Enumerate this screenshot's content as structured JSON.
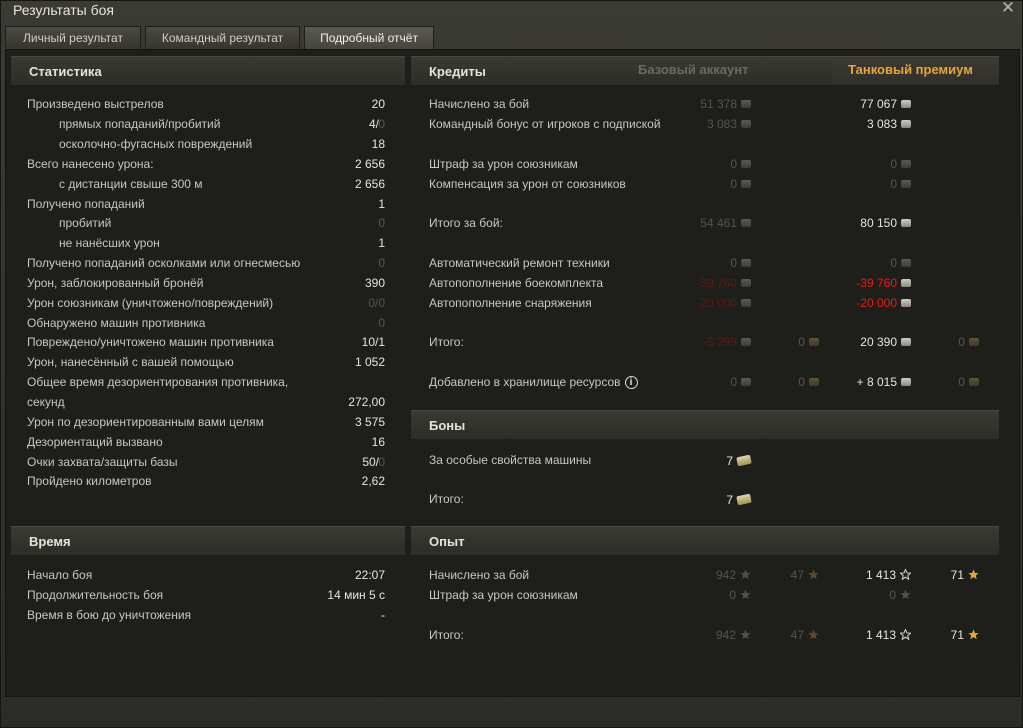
{
  "window": {
    "title": "Результаты боя",
    "close": "✕"
  },
  "tabs": [
    "Личный результат",
    "Командный результат",
    "Подробный отчёт"
  ],
  "stats": {
    "title": "Статистика",
    "rows": [
      {
        "label": "Произведено выстрелов",
        "value": "20"
      },
      {
        "label": "прямых попаданий/пробитий",
        "value": "4/",
        "value2": "0"
      },
      {
        "label": "осколочно-фугасных повреждений",
        "value": "18"
      },
      {
        "label": "Всего нанесено урона:",
        "value": "2 656"
      },
      {
        "label": "с дистанции свыше 300 м",
        "value": "2 656"
      },
      {
        "label": "Получено попаданий",
        "value": "1"
      },
      {
        "label": "пробитий",
        "value": "0"
      },
      {
        "label": "не нанёсших урон",
        "value": "1"
      },
      {
        "label": "Получено попаданий осколками или огнесмесью",
        "value": "0"
      },
      {
        "label": "Урон, заблокированный бронёй",
        "value": "390"
      },
      {
        "label": "Урон союзникам (уничтожено/повреждений)",
        "value": "0/0"
      },
      {
        "label": "Обнаружено машин противника",
        "value": "0"
      },
      {
        "label": "Повреждено/уничтожено машин противника",
        "value": "10/1"
      },
      {
        "label": "Урон, нанесённый с вашей помощью",
        "value": "1 052"
      },
      {
        "label": "Общее время дезориентирования противника,",
        "value": ""
      },
      {
        "label": "секунд",
        "value": "272,00"
      },
      {
        "label": "Урон по дезориентированным вами целям",
        "value": "3 575"
      },
      {
        "label": "Дезориентаций вызвано",
        "value": "16"
      },
      {
        "label": "Очки захвата/защиты базы",
        "value": "50/",
        "value2": "0"
      },
      {
        "label": "Пройдено километров",
        "value": "2,62"
      }
    ]
  },
  "time": {
    "title": "Время",
    "rows": [
      {
        "label": "Начало боя",
        "value": "22:07"
      },
      {
        "label": "Продолжительность боя",
        "value": "14 мин 5 с"
      },
      {
        "label": "Время в бою до уничтожения",
        "value": "-"
      }
    ]
  },
  "credits": {
    "title": "Кредиты",
    "col_base": "Базовый аккаунт",
    "col_prem": "Танковый премиум",
    "rows": [
      {
        "label": "Начислено за бой",
        "base": "51 378",
        "prem": "77 067"
      },
      {
        "label": "Командный бонус от игроков с подпиской",
        "base": "3 083",
        "prem": "3 083"
      },
      {
        "label": "Штраф за урон союзникам",
        "base": "0",
        "prem": "0"
      },
      {
        "label": "Компенсация за урон от союзников",
        "base": "0",
        "prem": "0"
      },
      {
        "label": "Итого за бой:",
        "base": "54 461",
        "prem": "80 150"
      },
      {
        "label": "Автоматический ремонт техники",
        "base": "0",
        "prem": "0"
      },
      {
        "label": "Автопополнение боекомплекта",
        "base": "-39 760",
        "prem": "-39 760"
      },
      {
        "label": "Автопополнение снаряжения",
        "base": "-20 000",
        "prem": "-20 000"
      },
      {
        "label": "Итого:",
        "base": "-5 299",
        "base_gold": "0",
        "prem": "20 390",
        "prem_gold": "0"
      },
      {
        "label": "Добавлено в хранилище ресурсов",
        "base": "0",
        "base_gold": "0",
        "prem": "+ 8 015",
        "prem_gold": "0"
      }
    ]
  },
  "bonds": {
    "title": "Боны",
    "rows": [
      {
        "label": "За особые свойства машины",
        "value": "7"
      },
      {
        "label": "Итого:",
        "value": "7"
      }
    ]
  },
  "xp": {
    "title": "Опыт",
    "rows": [
      {
        "label": "Начислено за бой",
        "base": "942",
        "base_free": "47",
        "prem": "1 413",
        "prem_free": "71"
      },
      {
        "label": "Штраф за урон союзникам",
        "base": "0",
        "prem": "0"
      },
      {
        "label": "Итого:",
        "base": "942",
        "base_free": "47",
        "prem": "1 413",
        "prem_free": "71"
      }
    ]
  }
}
